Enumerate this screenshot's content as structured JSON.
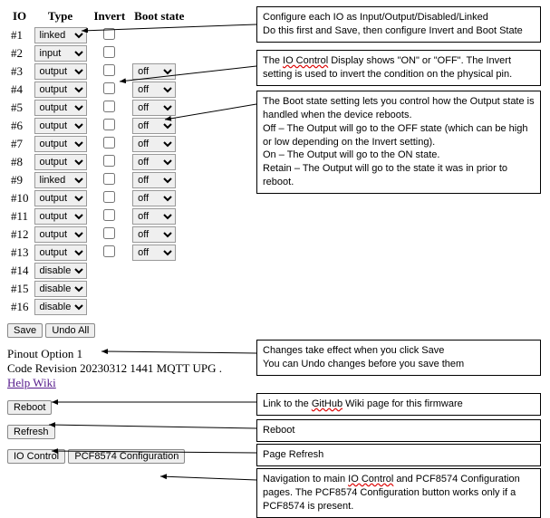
{
  "headers": {
    "io": "IO",
    "type": "Type",
    "invert": "Invert",
    "boot": "Boot state"
  },
  "rows": [
    {
      "id": "#1",
      "type": "linked",
      "invert": false,
      "boot": null
    },
    {
      "id": "#2",
      "type": "input",
      "invert": false,
      "boot": null
    },
    {
      "id": "#3",
      "type": "output",
      "invert": false,
      "boot": "off"
    },
    {
      "id": "#4",
      "type": "output",
      "invert": false,
      "boot": "off"
    },
    {
      "id": "#5",
      "type": "output",
      "invert": false,
      "boot": "off"
    },
    {
      "id": "#6",
      "type": "output",
      "invert": false,
      "boot": "off"
    },
    {
      "id": "#7",
      "type": "output",
      "invert": false,
      "boot": "off"
    },
    {
      "id": "#8",
      "type": "output",
      "invert": false,
      "boot": "off"
    },
    {
      "id": "#9",
      "type": "linked",
      "invert": false,
      "boot": "off"
    },
    {
      "id": "#10",
      "type": "output",
      "invert": false,
      "boot": "off"
    },
    {
      "id": "#11",
      "type": "output",
      "invert": false,
      "boot": "off"
    },
    {
      "id": "#12",
      "type": "output",
      "invert": false,
      "boot": "off"
    },
    {
      "id": "#13",
      "type": "output",
      "invert": false,
      "boot": "off"
    },
    {
      "id": "#14",
      "type": "disabled",
      "invert": null,
      "boot": null
    },
    {
      "id": "#15",
      "type": "disabled",
      "invert": null,
      "boot": null
    },
    {
      "id": "#16",
      "type": "disabled",
      "invert": null,
      "boot": null
    }
  ],
  "buttons": {
    "save": "Save",
    "undo": "Undo All",
    "reboot": "Reboot",
    "refresh": "Refresh",
    "io_control": "IO Control",
    "pcf_config": "PCF8574 Configuration"
  },
  "info": {
    "pinout": "Pinout Option 1",
    "code_rev": "Code Revision 20230312 1441 MQTT UPG .",
    "help": "Help Wiki"
  },
  "callouts": {
    "c1a": "Configure each IO as Input/Output/Disabled/Linked",
    "c1b": "Do this first and Save, then configure Invert and Boot State",
    "c2a": "The ",
    "c2b": "IO Control",
    "c2c": " Display shows \"ON\" or \"OFF\". The Invert setting is used to invert the condition on the physical pin.",
    "c3a": "The Boot state setting lets you control how the Output state is handled when the device reboots.",
    "c3b": "Off – The Output will go to the OFF state (which can be high or low depending on the Invert setting).",
    "c3c": "On – The Output will go to the ON state.",
    "c3d": "Retain – The Output will go to the state it was in prior to reboot.",
    "c4a": "Changes take effect when you click Save",
    "c4b": "You can Undo changes before you save them",
    "c5": "Link to the ",
    "c5b": "GitHub",
    "c5c": " Wiki page for this firmware",
    "c6": "Reboot",
    "c7": "Page Refresh",
    "c8a": "Navigation to main ",
    "c8b": "IO Control",
    "c8c": " and PCF8574 Configuration pages. The PCF8574 Configuration button works only if a PCF8574 is present."
  }
}
